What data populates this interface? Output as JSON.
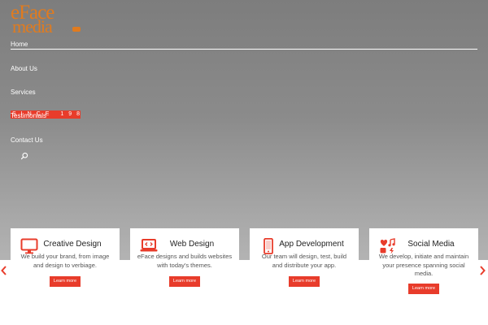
{
  "brand": {
    "logo_line1": "eFace",
    "logo_line2": "media",
    "accent_color": "#e83c2b",
    "logo_color": "#e07b1f"
  },
  "nav": {
    "items": [
      {
        "label": "Home",
        "active": true
      },
      {
        "label": "About Us"
      },
      {
        "label": "Services"
      },
      {
        "label": "Testimonials"
      },
      {
        "label": "Contact Us"
      }
    ],
    "search_icon": "search-icon"
  },
  "hero": {
    "since_text": "SINCE 1989"
  },
  "services": [
    {
      "title": "Creative Design",
      "description": "We build your brand, from image and design to verbiage.",
      "button": "Learn more",
      "icon": "monitor-icon"
    },
    {
      "title": "Web Design",
      "description": "eFace designs and builds websites with today's themes.",
      "button": "Learn more",
      "icon": "code-laptop-icon"
    },
    {
      "title": "App Development",
      "description": "Our team will design, test, build and distribute your app.",
      "button": "Learn more",
      "icon": "mobile-icon"
    },
    {
      "title": "Social Media",
      "description": "We develop, initiate and maintain your presence spanning social media.",
      "button": "Learn more",
      "icon": "social-icon"
    }
  ],
  "carousel": {
    "prev_icon": "chevron-left-icon",
    "next_icon": "chevron-right-icon"
  }
}
